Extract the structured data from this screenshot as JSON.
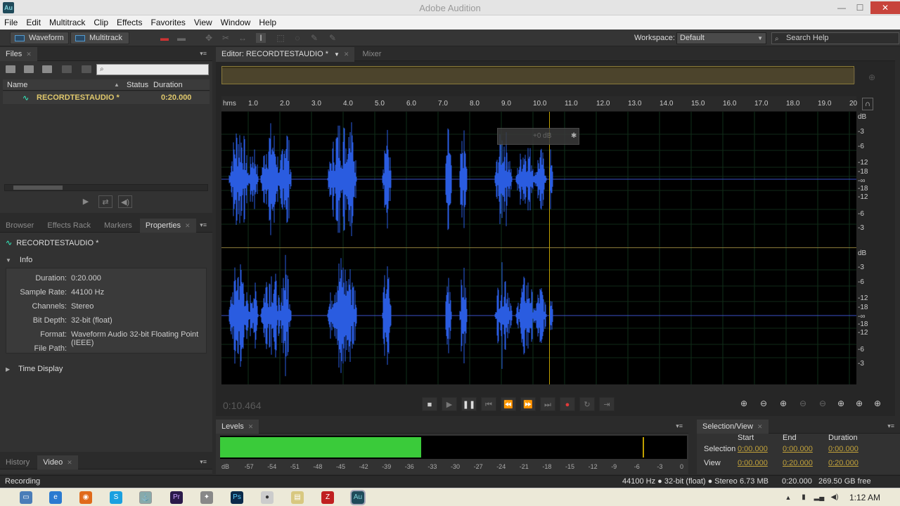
{
  "window": {
    "title": "Adobe Audition",
    "app_icon": "Au"
  },
  "menu": [
    "File",
    "Edit",
    "Multitrack",
    "Clip",
    "Effects",
    "Favorites",
    "View",
    "Window",
    "Help"
  ],
  "toolbar": {
    "waveform_label": "Waveform",
    "multitrack_label": "Multitrack",
    "workspace_label": "Workspace:",
    "workspace_value": "Default",
    "search_placeholder": "Search Help"
  },
  "files_panel": {
    "tab": "Files",
    "columns": {
      "name": "Name",
      "status": "Status",
      "duration": "Duration"
    },
    "rows": [
      {
        "name": "RECORDTESTAUDIO *",
        "duration": "0:20.000"
      }
    ]
  },
  "properties_panel": {
    "tabs": [
      "Browser",
      "Effects Rack",
      "Markers",
      "Properties"
    ],
    "file_name": "RECORDTESTAUDIO *",
    "info_heading": "Info",
    "info": [
      {
        "k": "Duration:",
        "v": "0:20.000"
      },
      {
        "k": "Sample Rate:",
        "v": "44100 Hz"
      },
      {
        "k": "Channels:",
        "v": "Stereo"
      },
      {
        "k": "Bit Depth:",
        "v": "32-bit (float)"
      },
      {
        "k": "Format:",
        "v": "Waveform Audio 32-bit Floating Point (IEEE)"
      },
      {
        "k": "File Path:",
        "v": ""
      }
    ],
    "time_display": "Time Display"
  },
  "history_panel": {
    "tabs": [
      "History",
      "Video"
    ]
  },
  "editor": {
    "tab": "Editor: RECORDTESTAUDIO *",
    "mixer_tab": "Mixer",
    "ruler_unit": "hms",
    "ruler_ticks": [
      "1.0",
      "2.0",
      "3.0",
      "4.0",
      "5.0",
      "6.0",
      "7.0",
      "8.0",
      "9.0",
      "10.0",
      "11.0",
      "12.0",
      "13.0",
      "14.0",
      "15.0",
      "16.0",
      "17.0",
      "18.0",
      "19.0",
      "20"
    ],
    "db_unit": "dB",
    "db_scale_top": [
      "-3",
      "-6",
      "-12",
      "-18",
      "-∞",
      "-18",
      "-12",
      "-6",
      "-3"
    ],
    "hud_gain": "+0 dB",
    "current_time": "0:10.464",
    "playhead_seconds": 10.464
  },
  "levels_panel": {
    "tab": "Levels",
    "scale": [
      "dB",
      "-57",
      "-54",
      "-51",
      "-48",
      "-45",
      "-42",
      "-39",
      "-36",
      "-33",
      "-30",
      "-27",
      "-24",
      "-21",
      "-18",
      "-15",
      "-12",
      "-9",
      "-6",
      "-3",
      "0"
    ],
    "level_fraction": 0.43,
    "peak_fraction": 0.905
  },
  "selection_panel": {
    "tab": "Selection/View",
    "headers": [
      "Start",
      "End",
      "Duration"
    ],
    "rows": [
      {
        "label": "Selection",
        "start": "0:00.000",
        "end": "0:00.000",
        "duration": "0:00.000"
      },
      {
        "label": "View",
        "start": "0:00.000",
        "end": "0:20.000",
        "duration": "0:20.000"
      }
    ]
  },
  "status": {
    "left": "Recording",
    "format": "44100 Hz ● 32-bit (float) ● Stereo",
    "size": "6.73 MB",
    "duration": "0:20.000",
    "free": "269.50 GB free"
  },
  "taskbar": {
    "clock": "1:12 AM"
  }
}
